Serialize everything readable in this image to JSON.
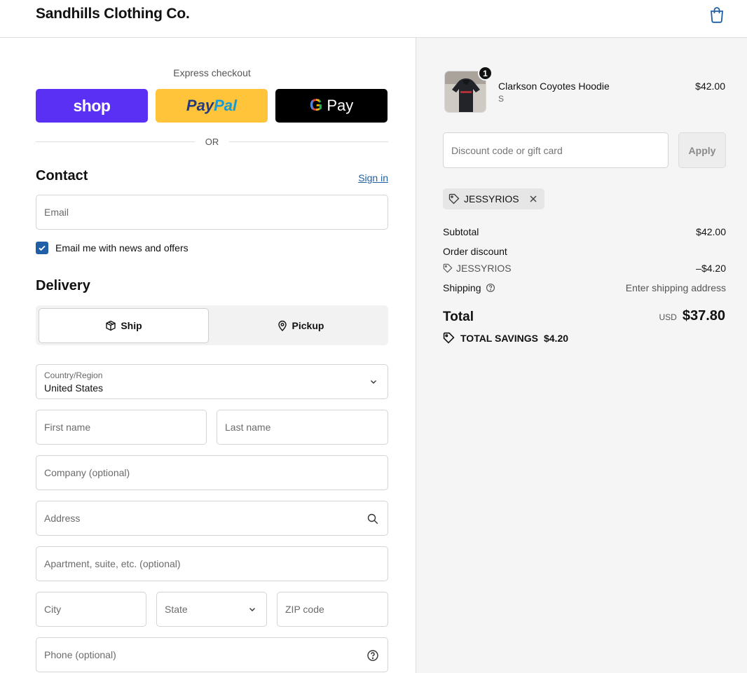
{
  "header": {
    "brand": "Sandhills Clothing Co.",
    "cart_icon": "shopping-bag-icon"
  },
  "express": {
    "label": "Express checkout",
    "shop_label": "shop",
    "paypal_part1": "Pay",
    "paypal_part2": "Pal",
    "gpay_g": "G",
    "gpay_label": "Pay",
    "or_label": "OR"
  },
  "contact": {
    "title": "Contact",
    "signin": "Sign in",
    "email_placeholder": "Email",
    "news_checkbox_label": "Email me with news and offers",
    "news_checked": true
  },
  "delivery": {
    "title": "Delivery",
    "ship_label": "Ship",
    "pickup_label": "Pickup",
    "country_label": "Country/Region",
    "country_value": "United States",
    "first_name_placeholder": "First name",
    "last_name_placeholder": "Last name",
    "company_placeholder": "Company (optional)",
    "address_placeholder": "Address",
    "apartment_placeholder": "Apartment, suite, etc. (optional)",
    "city_placeholder": "City",
    "state_label": "State",
    "zip_placeholder": "ZIP code",
    "phone_placeholder": "Phone (optional)"
  },
  "summary": {
    "item": {
      "name": "Clarkson Coyotes Hoodie",
      "variant": "S",
      "price": "$42.00",
      "qty": "1"
    },
    "discount_placeholder": "Discount code or gift card",
    "apply_label": "Apply",
    "applied_code": "JESSYRIOS",
    "subtotal_label": "Subtotal",
    "subtotal_value": "$42.00",
    "order_discount_label": "Order discount",
    "discount_code": "JESSYRIOS",
    "discount_value": "–$4.20",
    "shipping_label": "Shipping",
    "shipping_value": "Enter shipping address",
    "total_label": "Total",
    "currency": "USD",
    "total_value": "$37.80",
    "savings_label": "TOTAL SAVINGS",
    "savings_value": "$4.20"
  },
  "colors": {
    "accent": "#1f5fa8",
    "shop": "#5a31f4",
    "paypal": "#ffc439",
    "gpay": "#000000"
  }
}
